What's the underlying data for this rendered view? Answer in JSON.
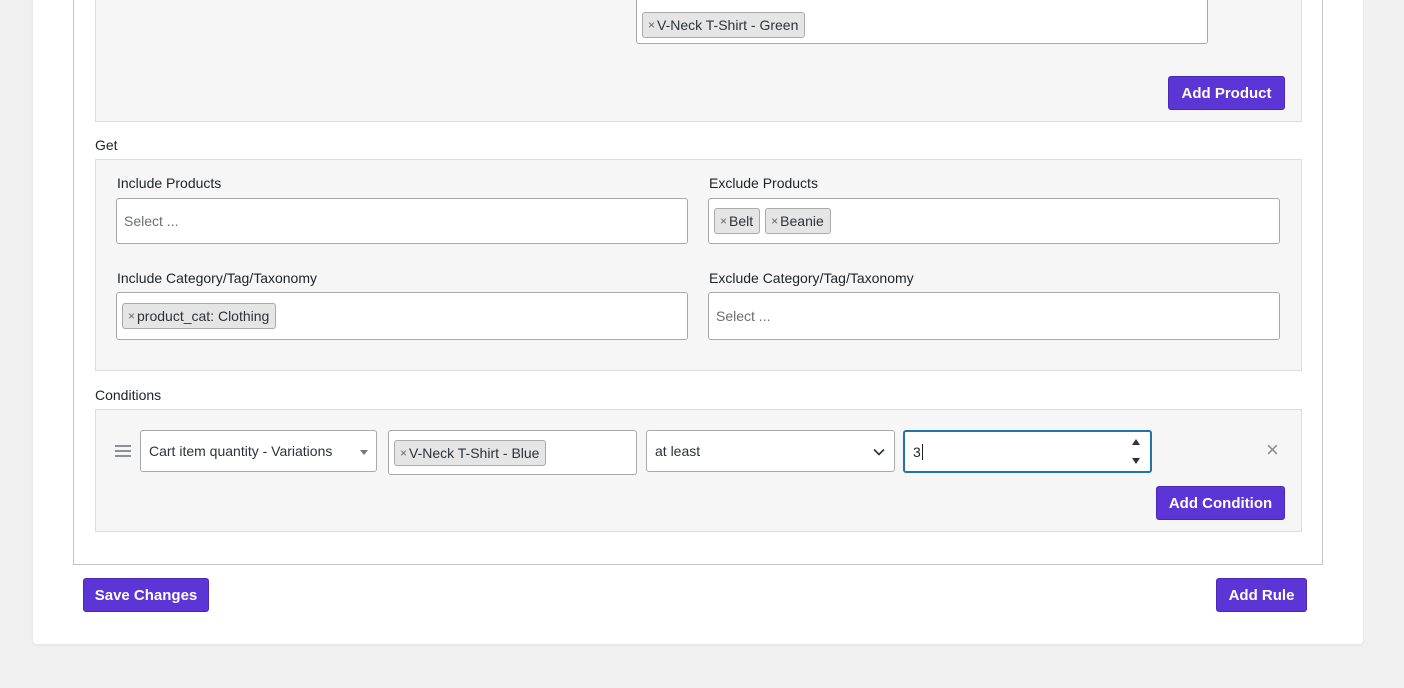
{
  "buy": {
    "product_chips": [
      "V-Neck T-Shirt - Green"
    ],
    "add_product_label": "Add Product"
  },
  "get": {
    "section_label": "Get",
    "include_products": {
      "label": "Include Products",
      "placeholder": "Select ..."
    },
    "exclude_products": {
      "label": "Exclude Products",
      "chips": [
        "Belt",
        "Beanie"
      ]
    },
    "include_taxonomy": {
      "label": "Include Category/Tag/Taxonomy",
      "chips": [
        "product_cat: Clothing"
      ]
    },
    "exclude_taxonomy": {
      "label": "Exclude Category/Tag/Taxonomy",
      "placeholder": "Select ..."
    }
  },
  "conditions": {
    "section_label": "Conditions",
    "type_value": "Cart item quantity - Variations",
    "product_chip": "V-Neck T-Shirt - Blue",
    "operator_value": "at least",
    "quantity_value": "3",
    "add_condition_label": "Add Condition"
  },
  "footer": {
    "save_label": "Save Changes",
    "add_rule_label": "Add Rule"
  },
  "icons": {
    "chip_remove": "×",
    "row_remove": "×"
  },
  "colors": {
    "accent": "#5b35d5",
    "focus": "#2271b1"
  }
}
